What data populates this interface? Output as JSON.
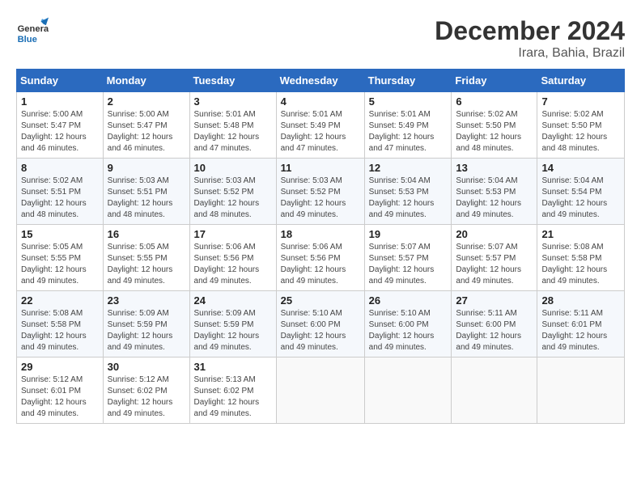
{
  "header": {
    "logo_general": "General",
    "logo_blue": "Blue",
    "month_title": "December 2024",
    "location": "Irara, Bahia, Brazil"
  },
  "weekdays": [
    "Sunday",
    "Monday",
    "Tuesday",
    "Wednesday",
    "Thursday",
    "Friday",
    "Saturday"
  ],
  "weeks": [
    [
      {
        "day": "1",
        "rise": "5:00 AM",
        "set": "5:47 PM",
        "daylight": "12 hours and 46 minutes."
      },
      {
        "day": "2",
        "rise": "5:00 AM",
        "set": "5:47 PM",
        "daylight": "12 hours and 46 minutes."
      },
      {
        "day": "3",
        "rise": "5:01 AM",
        "set": "5:48 PM",
        "daylight": "12 hours and 47 minutes."
      },
      {
        "day": "4",
        "rise": "5:01 AM",
        "set": "5:49 PM",
        "daylight": "12 hours and 47 minutes."
      },
      {
        "day": "5",
        "rise": "5:01 AM",
        "set": "5:49 PM",
        "daylight": "12 hours and 47 minutes."
      },
      {
        "day": "6",
        "rise": "5:02 AM",
        "set": "5:50 PM",
        "daylight": "12 hours and 48 minutes."
      },
      {
        "day": "7",
        "rise": "5:02 AM",
        "set": "5:50 PM",
        "daylight": "12 hours and 48 minutes."
      }
    ],
    [
      {
        "day": "8",
        "rise": "5:02 AM",
        "set": "5:51 PM",
        "daylight": "12 hours and 48 minutes."
      },
      {
        "day": "9",
        "rise": "5:03 AM",
        "set": "5:51 PM",
        "daylight": "12 hours and 48 minutes."
      },
      {
        "day": "10",
        "rise": "5:03 AM",
        "set": "5:52 PM",
        "daylight": "12 hours and 48 minutes."
      },
      {
        "day": "11",
        "rise": "5:03 AM",
        "set": "5:52 PM",
        "daylight": "12 hours and 49 minutes."
      },
      {
        "day": "12",
        "rise": "5:04 AM",
        "set": "5:53 PM",
        "daylight": "12 hours and 49 minutes."
      },
      {
        "day": "13",
        "rise": "5:04 AM",
        "set": "5:53 PM",
        "daylight": "12 hours and 49 minutes."
      },
      {
        "day": "14",
        "rise": "5:04 AM",
        "set": "5:54 PM",
        "daylight": "12 hours and 49 minutes."
      }
    ],
    [
      {
        "day": "15",
        "rise": "5:05 AM",
        "set": "5:55 PM",
        "daylight": "12 hours and 49 minutes."
      },
      {
        "day": "16",
        "rise": "5:05 AM",
        "set": "5:55 PM",
        "daylight": "12 hours and 49 minutes."
      },
      {
        "day": "17",
        "rise": "5:06 AM",
        "set": "5:56 PM",
        "daylight": "12 hours and 49 minutes."
      },
      {
        "day": "18",
        "rise": "5:06 AM",
        "set": "5:56 PM",
        "daylight": "12 hours and 49 minutes."
      },
      {
        "day": "19",
        "rise": "5:07 AM",
        "set": "5:57 PM",
        "daylight": "12 hours and 49 minutes."
      },
      {
        "day": "20",
        "rise": "5:07 AM",
        "set": "5:57 PM",
        "daylight": "12 hours and 49 minutes."
      },
      {
        "day": "21",
        "rise": "5:08 AM",
        "set": "5:58 PM",
        "daylight": "12 hours and 49 minutes."
      }
    ],
    [
      {
        "day": "22",
        "rise": "5:08 AM",
        "set": "5:58 PM",
        "daylight": "12 hours and 49 minutes."
      },
      {
        "day": "23",
        "rise": "5:09 AM",
        "set": "5:59 PM",
        "daylight": "12 hours and 49 minutes."
      },
      {
        "day": "24",
        "rise": "5:09 AM",
        "set": "5:59 PM",
        "daylight": "12 hours and 49 minutes."
      },
      {
        "day": "25",
        "rise": "5:10 AM",
        "set": "6:00 PM",
        "daylight": "12 hours and 49 minutes."
      },
      {
        "day": "26",
        "rise": "5:10 AM",
        "set": "6:00 PM",
        "daylight": "12 hours and 49 minutes."
      },
      {
        "day": "27",
        "rise": "5:11 AM",
        "set": "6:00 PM",
        "daylight": "12 hours and 49 minutes."
      },
      {
        "day": "28",
        "rise": "5:11 AM",
        "set": "6:01 PM",
        "daylight": "12 hours and 49 minutes."
      }
    ],
    [
      {
        "day": "29",
        "rise": "5:12 AM",
        "set": "6:01 PM",
        "daylight": "12 hours and 49 minutes."
      },
      {
        "day": "30",
        "rise": "5:12 AM",
        "set": "6:02 PM",
        "daylight": "12 hours and 49 minutes."
      },
      {
        "day": "31",
        "rise": "5:13 AM",
        "set": "6:02 PM",
        "daylight": "12 hours and 49 minutes."
      },
      null,
      null,
      null,
      null
    ]
  ],
  "labels": {
    "sunrise": "Sunrise:",
    "sunset": "Sunset:",
    "daylight": "Daylight:"
  }
}
